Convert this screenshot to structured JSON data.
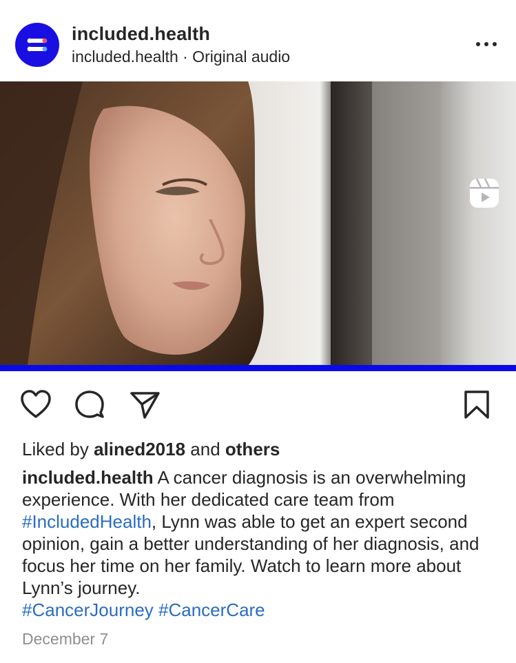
{
  "header": {
    "username": "included.health",
    "subline": "included.health · Original audio"
  },
  "media": {
    "progress_percent": 100
  },
  "likes": {
    "prefix": "Liked by ",
    "user": "alined2018",
    "middle": " and ",
    "others": "others"
  },
  "caption": {
    "username": "included.health",
    "text_1": " A cancer diagnosis is an overwhelming experience. With her dedicated care team from ",
    "hashtag_1": "#IncludedHealth",
    "text_2": ", Lynn was able to get an expert second opinion, gain a better understanding of her diagnosis, and focus her time on her family. Watch to learn more about Lynn’s journey.",
    "hashtag_2": "#CancerJourney",
    "hashtag_3": "#CancerCare"
  },
  "date": "December 7",
  "colors": {
    "brand": "#1a0fe3",
    "link": "#2a6cc0",
    "progress": "#0a0ae8"
  },
  "icons": [
    "more-options-icon",
    "reels-icon",
    "brand-watermark-icon",
    "muted-speaker-icon",
    "heart-icon",
    "comment-icon",
    "paper-plane-icon",
    "bookmark-icon"
  ]
}
